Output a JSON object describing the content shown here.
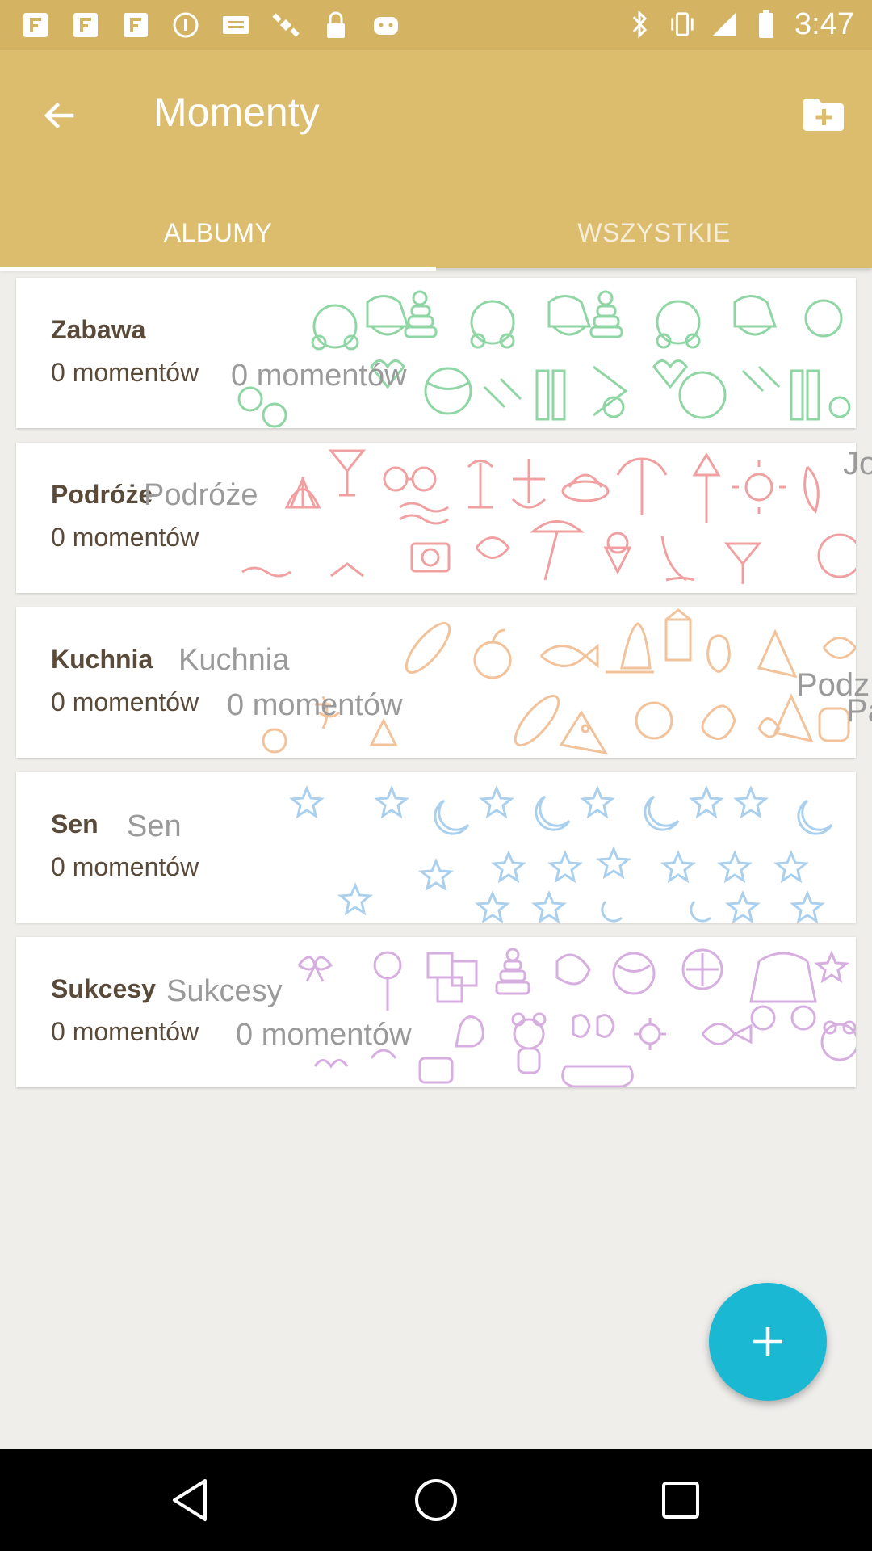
{
  "status_bar": {
    "time": "3:47",
    "left_icons": [
      "app-icon",
      "app-icon",
      "app-icon",
      "info-icon",
      "mail-icon",
      "satellite-icon",
      "lock-icon",
      "android-icon"
    ],
    "right_icons": [
      "bluetooth-icon",
      "vibrate-icon",
      "signal-icon",
      "battery-icon"
    ]
  },
  "app_bar": {
    "title": "Momenty",
    "tabs": [
      {
        "label": "ALBUMY",
        "selected": true
      },
      {
        "label": "WSZYSTKIE",
        "selected": false
      }
    ]
  },
  "albums": [
    {
      "name": "Zabawa",
      "count": "0 momentów",
      "ghost_name": "",
      "ghost_count": "0 momentów",
      "pattern": "toys",
      "pattern_color": "#8fd6a4"
    },
    {
      "name": "Podróże",
      "count": "0 momentów",
      "ghost_name": "Podróże",
      "ghost_count": "",
      "pattern": "travel",
      "pattern_color": "#f0a0a0"
    },
    {
      "name": "Kuchnia",
      "count": "0 momentów",
      "ghost_name": "Kuchnia",
      "ghost_count": "0 momentów",
      "pattern": "food",
      "pattern_color": "#f2c29b"
    },
    {
      "name": "Sen",
      "count": "0 momentów",
      "ghost_name": "Sen",
      "ghost_count": "",
      "pattern": "night",
      "pattern_color": "#aad0ee"
    },
    {
      "name": "Sukcesy",
      "count": "0 momentów",
      "ghost_name": "Sukcesy",
      "ghost_count": "0 momentów",
      "pattern": "baby",
      "pattern_color": "#d7aee0"
    }
  ],
  "ghost_edge": {
    "text1": "Jo",
    "text2": "Podz",
    "text3": "Pa"
  },
  "colors": {
    "status_bar": "#d4b463",
    "app_bar": "#dcbd6e",
    "fab": "#1ab8d3",
    "background": "#efeeeb"
  },
  "fab": {
    "icon": "plus-icon"
  },
  "nav": {
    "icons": [
      "back-triangle-icon",
      "home-circle-icon",
      "recents-square-icon"
    ]
  }
}
